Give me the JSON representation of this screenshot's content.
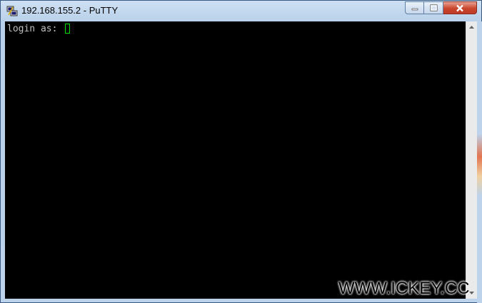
{
  "window": {
    "title": "192.168.155.2 - PuTTY",
    "icon": "putty-icon"
  },
  "caption_buttons": {
    "minimize_icon": "minimize-icon",
    "maximize_icon": "maximize-icon",
    "close_icon": "close-icon"
  },
  "terminal": {
    "prompt": "login as: ",
    "background": "#000000",
    "text_color": "#c0c0c0",
    "cursor_color": "#00e000"
  },
  "scrollbar": {
    "up_icon": "scroll-up-arrow-icon",
    "down_icon": "scroll-down-arrow-icon"
  },
  "watermark": {
    "text": "WWW.ICKEY.CC"
  }
}
